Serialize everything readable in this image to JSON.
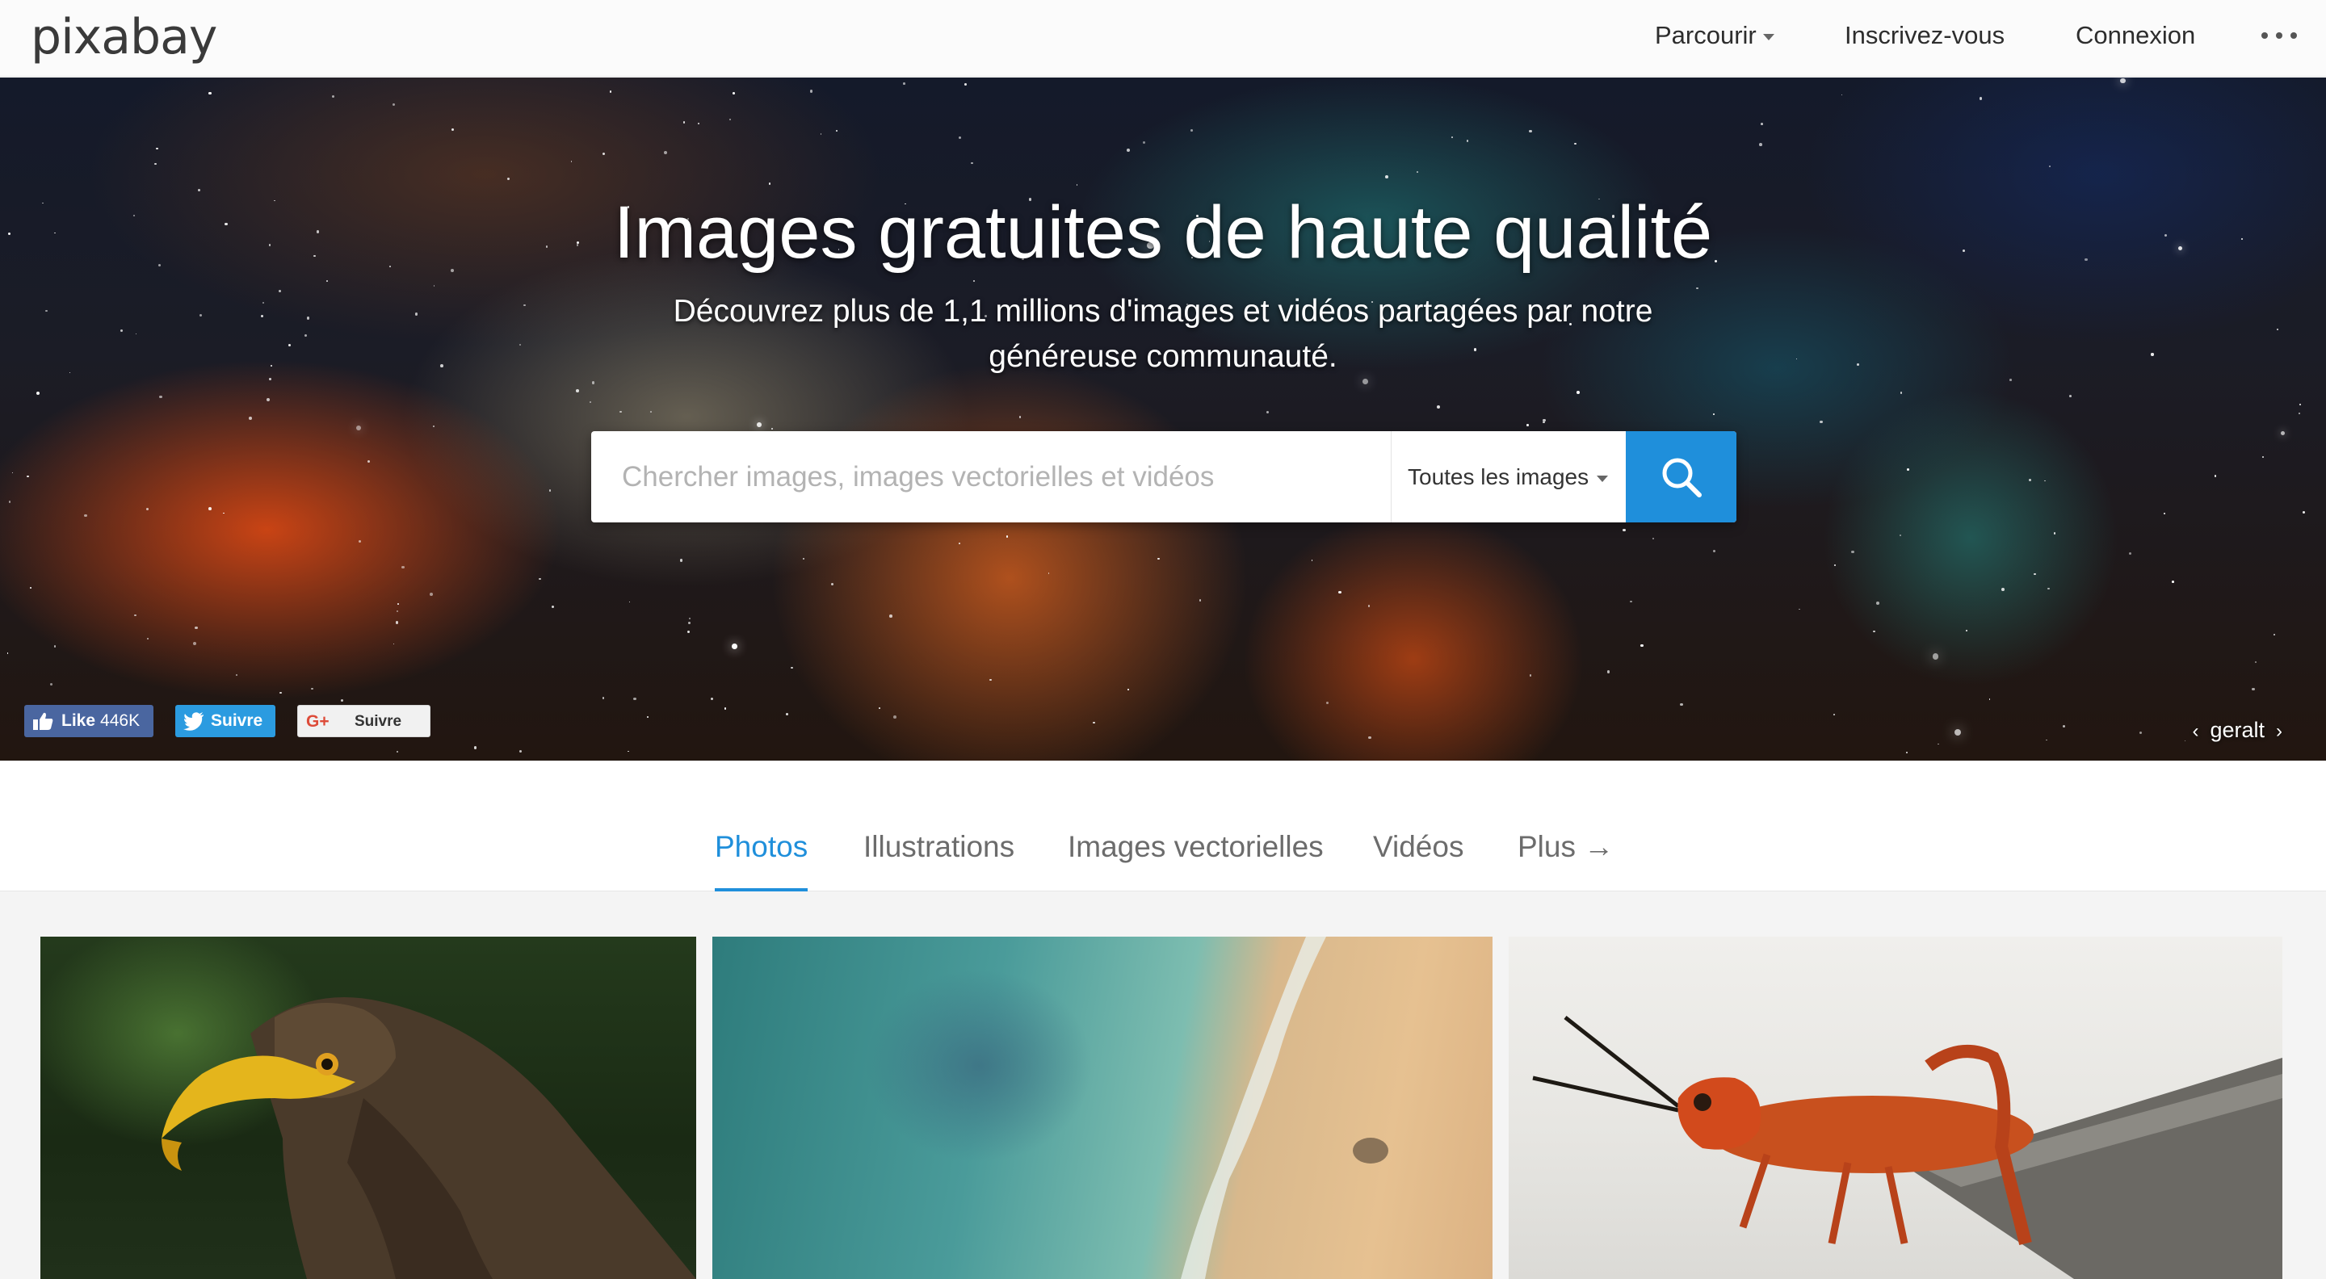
{
  "header": {
    "logo": "pixabay",
    "nav": {
      "browse": "Parcourir",
      "signup": "Inscrivez-vous",
      "login": "Connexion"
    }
  },
  "hero": {
    "title": "Images gratuites de haute qualité",
    "subtitle": "Découvrez plus de 1,1 millions d'images et vidéos partagées par notre généreuse communauté.",
    "search": {
      "placeholder": "Chercher images, images vectorielles et vidéos",
      "type_label": "Toutes les images"
    },
    "social": {
      "facebook_label": "Like",
      "facebook_count": "446K",
      "twitter_label": "Suivre",
      "googleplus_label": "Suivre"
    },
    "credit": {
      "author": "geralt",
      "prev": "‹",
      "next": "›"
    }
  },
  "tabs": [
    {
      "label": "Photos",
      "active": true
    },
    {
      "label": "Illustrations",
      "active": false
    },
    {
      "label": "Images vectorielles",
      "active": false
    },
    {
      "label": "Vidéos",
      "active": false
    },
    {
      "label": "Plus →",
      "active": false
    }
  ],
  "gallery": {
    "photos": [
      "eagle",
      "sea-shore",
      "grasshopper"
    ]
  },
  "colors": {
    "accent": "#1f8fdb",
    "facebook": "#4a66a0",
    "twitter": "#2b9be0"
  }
}
